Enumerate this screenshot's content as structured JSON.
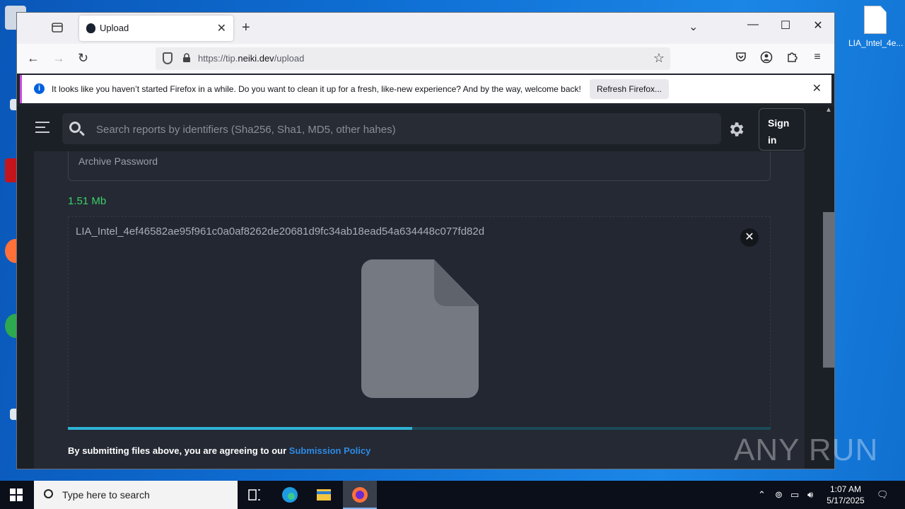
{
  "desktop": {
    "file_label": "LIA_Intel_4e..."
  },
  "browser": {
    "tab_title": "Upload",
    "url_prefix": "https://tip.",
    "url_domain": "neiki.dev",
    "url_path": "/upload",
    "infobar_message": "It looks like you haven’t started Firefox in a while. Do you want to clean it up for a fresh, like-new experience? And by the way, welcome back!",
    "infobar_button": "Refresh Firefox..."
  },
  "page": {
    "search_placeholder": "Search reports by identifiers (Sha256, Sha1, MD5, other hahes)",
    "sign_in": "Sign in",
    "archive_password_label": "Archive Password",
    "file_size": "1.51 Mb",
    "file_name": "LIA_Intel_4ef46582ae95f961c0a0af8262de20681d9fc34ab18ead54a634448c077fd82d",
    "upload_progress": 0.49,
    "policy_text": "By submitting files above, you are agreeing to our ",
    "policy_link": "Submission Policy"
  },
  "watermark": "ANY RUN",
  "taskbar": {
    "search_text": "Type here to search",
    "time": "1:07 AM",
    "date": "5/17/2025"
  },
  "colors": {
    "accent_link": "#2e8ae6",
    "file_size_green": "#3ecf6a",
    "progress_fill": "#2fb3d6"
  }
}
